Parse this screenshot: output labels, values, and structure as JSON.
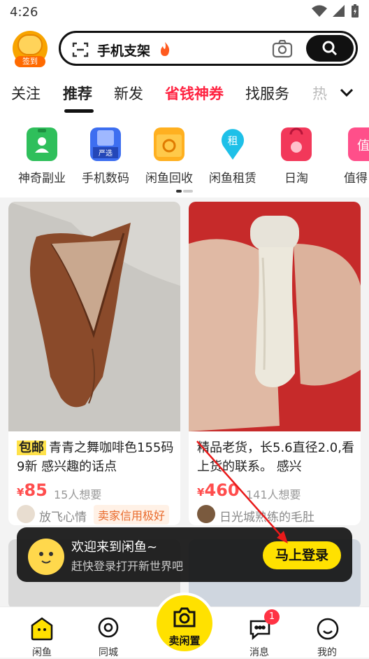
{
  "status_bar": {
    "time": "4:26"
  },
  "header": {
    "sign_badge_label": "签到",
    "search_query": "手机支架"
  },
  "tabs": [
    {
      "label": "关注"
    },
    {
      "label": "推荐"
    },
    {
      "label": "新发"
    },
    {
      "label": "省钱神券"
    },
    {
      "label": "找服务"
    },
    {
      "label": "热"
    }
  ],
  "categories": [
    {
      "label": "神奇副业"
    },
    {
      "label": "手机数码"
    },
    {
      "label": "闲鱼回收"
    },
    {
      "label": "闲鱼租赁"
    },
    {
      "label": "日淘"
    },
    {
      "label": "值得"
    }
  ],
  "products": [
    {
      "ship_tag": "包邮",
      "title": "青青之舞咖啡色155码 9新 感兴趣的话点",
      "currency": "¥",
      "price": "85",
      "wants": "15人想要",
      "seller": "放飞心情",
      "credit": "卖家信用极好"
    },
    {
      "title": "精品老货，长5.6直径2.0,看上货的联系。 感兴",
      "currency": "¥",
      "price": "460",
      "wants": "141人想要",
      "seller": "日光城熟练的毛肚"
    }
  ],
  "login_banner": {
    "title": "欢迎来到闲鱼~",
    "subtitle": "赶快登录打开新世界吧",
    "button": "马上登录"
  },
  "tabbar": {
    "home": "闲鱼",
    "city": "同城",
    "sell": "卖闲置",
    "messages": "消息",
    "messages_badge": "1",
    "mine": "我的"
  }
}
